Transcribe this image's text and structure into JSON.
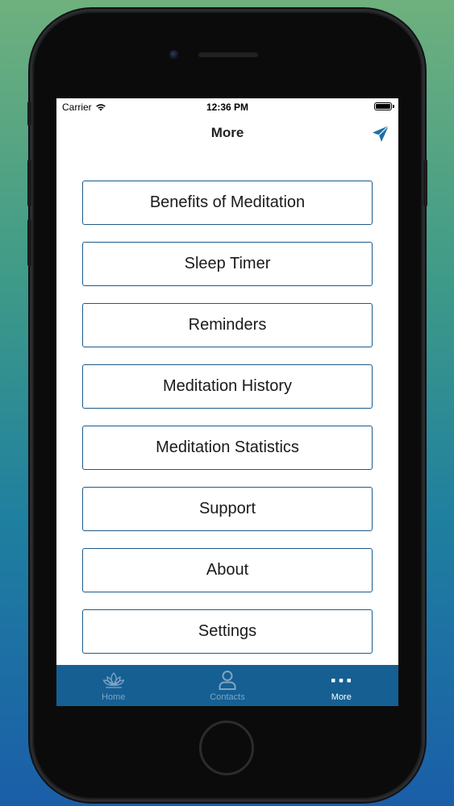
{
  "status_bar": {
    "carrier": "Carrier",
    "time": "12:36 PM",
    "wifi_icon": "wifi-icon",
    "battery_icon": "battery-icon"
  },
  "nav": {
    "title": "More",
    "action_icon": "send-icon"
  },
  "menu": [
    {
      "label": "Benefits of Meditation"
    },
    {
      "label": "Sleep Timer"
    },
    {
      "label": "Reminders"
    },
    {
      "label": "Meditation History"
    },
    {
      "label": "Meditation Statistics"
    },
    {
      "label": "Support"
    },
    {
      "label": "About"
    },
    {
      "label": "Settings"
    }
  ],
  "tabs": [
    {
      "label": "Home",
      "icon": "lotus-icon",
      "active": false
    },
    {
      "label": "Contacts",
      "icon": "person-icon",
      "active": false
    },
    {
      "label": "More",
      "icon": "more-dots-icon",
      "active": true
    }
  ],
  "colors": {
    "accent": "#1c5a8a",
    "tab_bar": "#155f93",
    "tab_inactive": "#7fa4c4",
    "tab_active": "#ffffff",
    "send_icon": "#1e6fa6"
  }
}
